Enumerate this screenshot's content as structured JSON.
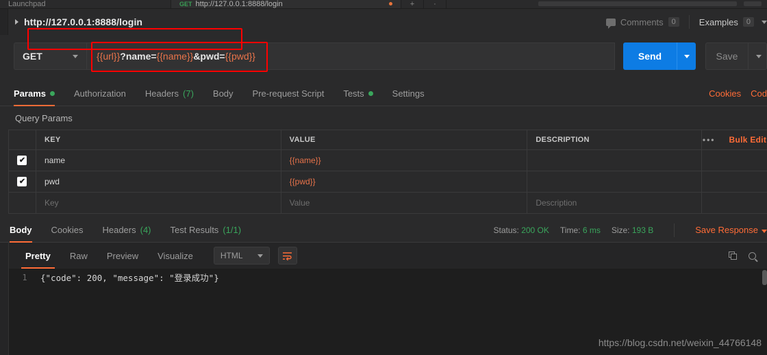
{
  "window": {
    "top_tabs": [
      {
        "label": "Launchpad",
        "method": "",
        "dirty": false
      },
      {
        "label": "http://127.0.0.1:8888/login",
        "method": "GET",
        "dirty": true
      },
      {
        "label": "+",
        "method": "",
        "dirty": false
      },
      {
        "label": "·",
        "method": "",
        "dirty": false
      }
    ]
  },
  "request": {
    "title": "http://127.0.0.1:8888/login",
    "comments_label": "Comments",
    "comments_count": "0",
    "examples_label": "Examples",
    "examples_count": "0",
    "method": "GET",
    "url_prefix": "{{url}}",
    "url_mid": "?name=",
    "url_name_var": "{{name}}",
    "url_amp": "&pwd=",
    "url_pwd_var": "{{pwd}}",
    "send_label": "Send",
    "save_label": "Save",
    "tabs": [
      {
        "label": "Params",
        "badge": "",
        "dot": true,
        "active": true
      },
      {
        "label": "Authorization",
        "badge": "",
        "dot": false,
        "active": false
      },
      {
        "label": "Headers",
        "badge": "(7)",
        "dot": false,
        "active": false
      },
      {
        "label": "Body",
        "badge": "",
        "dot": false,
        "active": false
      },
      {
        "label": "Pre-request Script",
        "badge": "",
        "dot": false,
        "active": false
      },
      {
        "label": "Tests",
        "badge": "",
        "dot": true,
        "active": false
      },
      {
        "label": "Settings",
        "badge": "",
        "dot": false,
        "active": false
      }
    ],
    "cookies_link": "Cookies",
    "code_link": "Cod"
  },
  "params": {
    "section_label": "Query Params",
    "columns": [
      "KEY",
      "VALUE",
      "DESCRIPTION"
    ],
    "bulk_edit_label": "Bulk Edit",
    "more_icon": "•••",
    "rows": [
      {
        "checked": true,
        "key": "name",
        "value": "{{name}}",
        "description": ""
      },
      {
        "checked": true,
        "key": "pwd",
        "value": "{{pwd}}",
        "description": ""
      }
    ],
    "placeholder_row": {
      "key": "Key",
      "value": "Value",
      "description": "Description"
    }
  },
  "response": {
    "tabs": [
      {
        "label": "Body",
        "badge": "",
        "active": true
      },
      {
        "label": "Cookies",
        "badge": "",
        "active": false
      },
      {
        "label": "Headers",
        "badge": "(4)",
        "active": false
      },
      {
        "label": "Test Results",
        "badge": "(1/1)",
        "active": false
      }
    ],
    "status_label": "Status:",
    "status_value": "200 OK",
    "time_label": "Time:",
    "time_value": "6 ms",
    "size_label": "Size:",
    "size_value": "193 B",
    "save_response_label": "Save Response",
    "view_tabs": [
      {
        "label": "Pretty",
        "active": true
      },
      {
        "label": "Raw",
        "active": false
      },
      {
        "label": "Preview",
        "active": false
      },
      {
        "label": "Visualize",
        "active": false
      }
    ],
    "format": "HTML",
    "line_number": "1",
    "body_text": "{\"code\": 200, \"message\": \"登录成功\"}"
  },
  "watermark": "https://blog.csdn.net/weixin_44766148",
  "colors": {
    "accent_orange": "#ff6c37",
    "send_blue": "#0d7ce4",
    "success_green": "#3aa65c",
    "highlight_red": "#ff0000",
    "variable_orange": "#e8734a"
  }
}
